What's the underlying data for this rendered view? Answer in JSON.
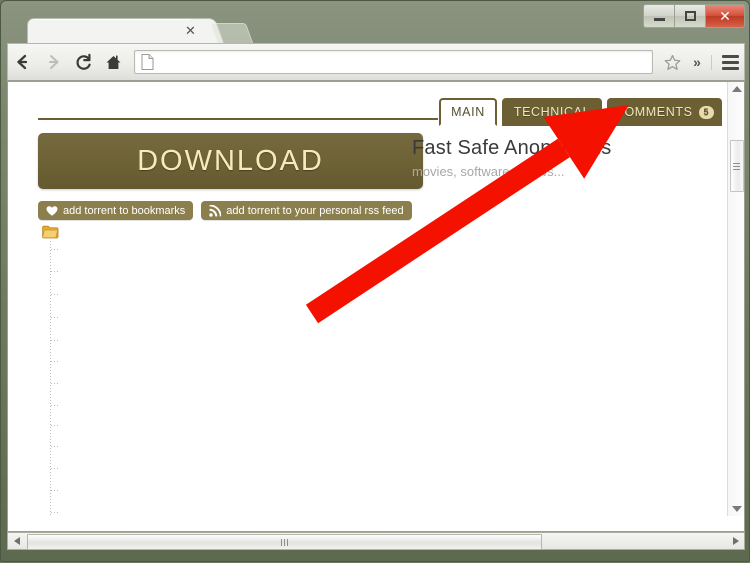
{
  "window": {
    "controls": {
      "minimize": "minimize",
      "maximize": "maximize",
      "close": "✕"
    }
  },
  "browser": {
    "tab": {
      "title": "",
      "close_label": "✕"
    },
    "new_tab_label": "",
    "nav": {
      "back": "←",
      "forward": "→",
      "reload": "⟳",
      "home": "⌂"
    },
    "address_bar": {
      "value": "",
      "placeholder": ""
    },
    "bookmark_star": "☆",
    "overflow": "»",
    "menu": "menu"
  },
  "page": {
    "tabs": [
      {
        "label": "MAIN",
        "active": true,
        "badge": ""
      },
      {
        "label": "TECHNICAL",
        "active": false,
        "badge": ""
      },
      {
        "label": "COMMENTS",
        "active": false,
        "badge": "5"
      }
    ],
    "download_button": "DOWNLOAD",
    "headline": "Fast Safe Anonymous",
    "subline": "movies, software, shows...",
    "chips": [
      {
        "label": "add torrent to bookmarks",
        "icon": "heart-icon"
      },
      {
        "label": "add torrent to your personal rss feed",
        "icon": "rss-icon"
      }
    ],
    "file_tree": {
      "root_icon": "folder-icon"
    }
  },
  "scrollbars": {
    "vertical": {
      "up": "▲",
      "down": "▼"
    },
    "horizontal": {
      "left": "◀",
      "right": "▶"
    }
  },
  "annotation": {
    "type": "arrow",
    "color": "#f51100",
    "points_to": "COMMENTS"
  },
  "colors": {
    "olive": "#6b5f33",
    "olive_light": "#8b7f4e",
    "cream": "#f7ebbd",
    "badge_bg": "#e8dcad",
    "window_chrome": "#6e7a60",
    "arrow_red": "#f51100"
  }
}
